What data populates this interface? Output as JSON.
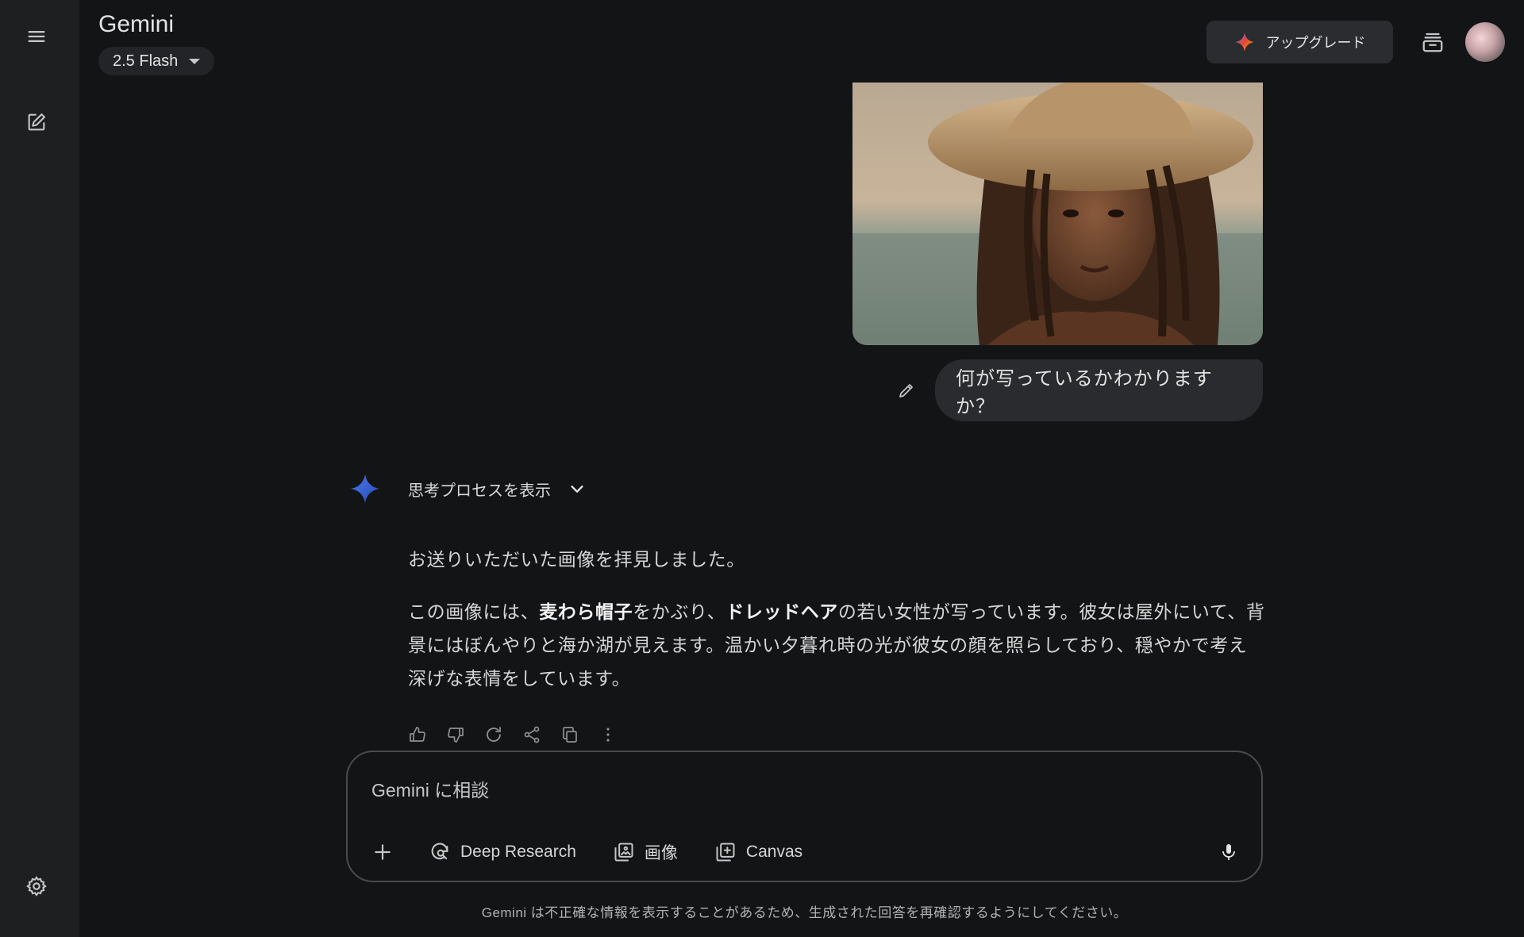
{
  "app": {
    "title": "Gemini",
    "model_selector": {
      "selected": "2.5 Flash"
    },
    "upgrade_label": "アップグレード"
  },
  "sidebar": {
    "icons": [
      "menu-icon",
      "new-chat-icon",
      "settings-icon"
    ]
  },
  "conversation": {
    "user_message": "何が写っているかわかりますか？",
    "thinking_toggle_label": "思考プロセスを表示",
    "response": {
      "p1": "お送りいただいた画像を拝見しました。",
      "p2_a": "この画像には、",
      "p2_bold1": "麦わら帽子",
      "p2_b": "をかぶり、",
      "p2_bold2": "ドレッドヘア",
      "p2_c": "の若い女性が写っています。彼女は屋外にいて、背景にはぼんやりと海か湖が見えます。温かい夕暮れ時の光が彼女の顔を照らしており、穏やかで考え深げな表情をしています。"
    },
    "response_actions": [
      "thumbs-up-icon",
      "thumbs-down-icon",
      "regenerate-icon",
      "share-icon",
      "copy-icon",
      "more-vert-icon"
    ]
  },
  "composer": {
    "placeholder": "Gemini に相談",
    "tools": {
      "deep_research": "Deep Research",
      "image": "画像",
      "canvas": "Canvas"
    }
  },
  "footer": {
    "disclaimer": "Gemini は不正確な情報を表示することがあるため、生成された回答を再確認するようにしてください。"
  },
  "colors": {
    "background": "#131416",
    "sidebar": "#1e1f21",
    "bubble": "#2a2b2e",
    "gemini_blue": "#3f6fe0"
  }
}
